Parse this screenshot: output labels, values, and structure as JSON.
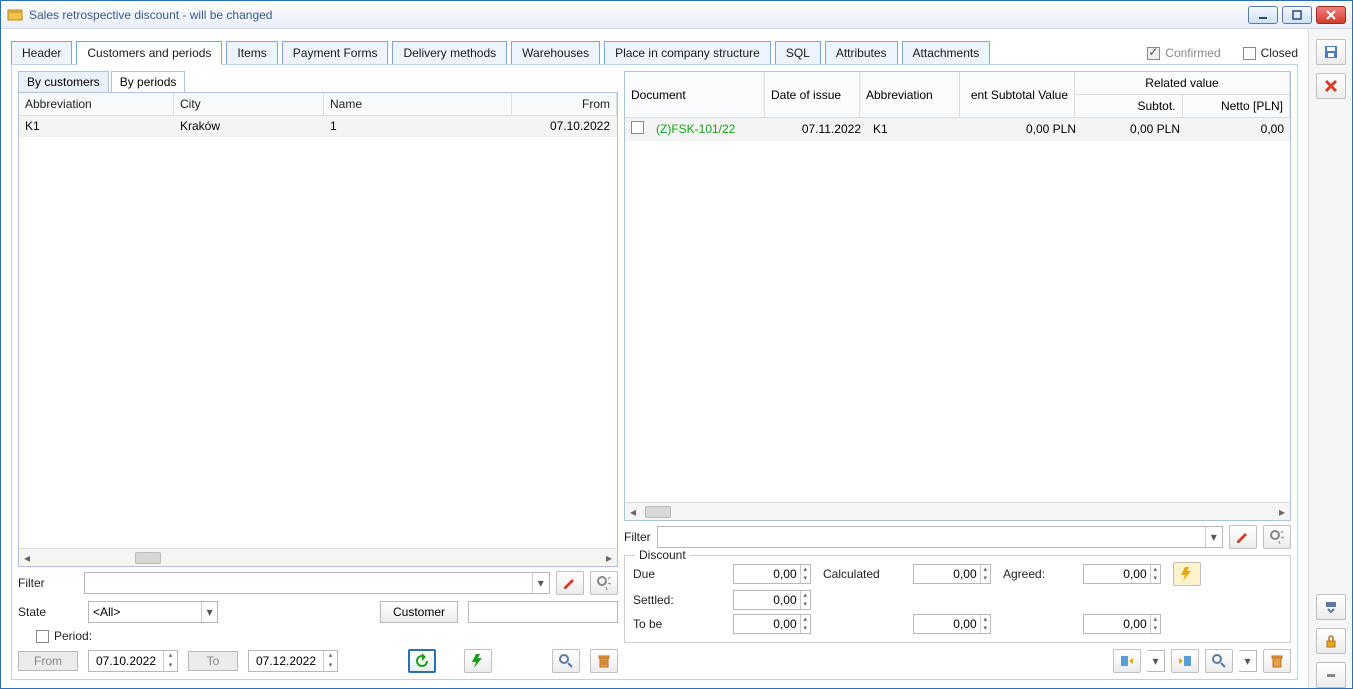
{
  "window": {
    "title": "Sales retrospective discount - will be changed"
  },
  "checkboxes": {
    "confirmed": "Confirmed",
    "closed": "Closed"
  },
  "tabs": [
    "Header",
    "Customers and periods",
    "Items",
    "Payment Forms",
    "Delivery methods",
    "Warehouses",
    "Place in company structure",
    "SQL",
    "Attributes",
    "Attachments"
  ],
  "active_tab": 1,
  "subtabs": [
    "By customers",
    "By periods"
  ],
  "active_subtab": 1,
  "left_grid": {
    "columns": [
      "Abbreviation",
      "City",
      "Name",
      "From"
    ],
    "rows": [
      {
        "abbr": "K1",
        "city": "Kraków",
        "name": "1",
        "from": "07.10.2022"
      }
    ]
  },
  "filter_label": "Filter",
  "state_label": "State",
  "state_value": "<All>",
  "customer_button": "Customer",
  "period_label": "Period:",
  "from_button": "From",
  "from_date": "07.10.2022",
  "to_button": "To",
  "to_date": "07.12.2022",
  "right_grid": {
    "col_document": "Document",
    "col_date": "Date of issue",
    "col_abbr": "Abbreviation",
    "col_subtotal_value": "ent Subtotal Value",
    "group_related": "Related value",
    "col_subtot": "Subtot.",
    "col_netto": "Netto [PLN]",
    "rows": [
      {
        "doc": "(Z)FSK-101/22",
        "date": "07.11.2022",
        "abbr": "K1",
        "subtotal_value": "0,00 PLN",
        "subtot": "0,00 PLN",
        "netto": "0,00"
      }
    ]
  },
  "right_filter_label": "Filter",
  "discount": {
    "legend": "Discount",
    "due": "Due",
    "calculated": "Calculated",
    "agreed": "Agreed:",
    "settled": "Settled:",
    "tobe": "To be",
    "val_due": "0,00",
    "val_calc": "0,00",
    "val_agreed": "0,00",
    "val_settled": "0,00",
    "val_tobe": "0,00",
    "val_tobe2": "0,00",
    "val_tobe3": "0,00"
  }
}
